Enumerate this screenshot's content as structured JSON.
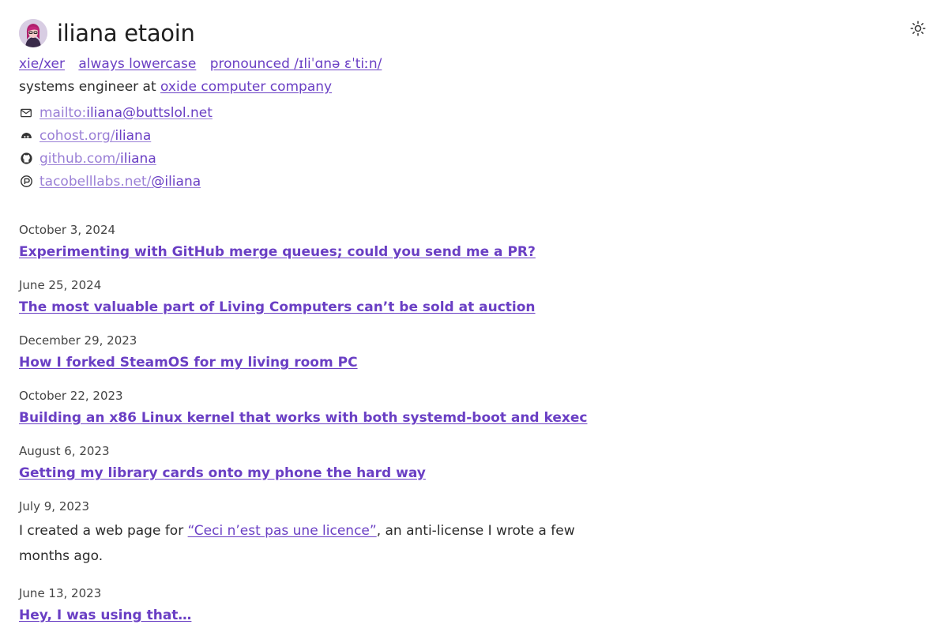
{
  "header": {
    "name": "iliana etaoin",
    "tags": [
      "xie/xer",
      "always lowercase",
      "pronounced /ɪliˈɑnə ɛˈtiːn/"
    ],
    "role_text": "systems engineer at ",
    "company_link": "oxide computer company"
  },
  "contacts": [
    {
      "icon": "mail-icon",
      "prefix": "mailto:",
      "handle": "iliana@buttslol.net"
    },
    {
      "icon": "cohost-icon",
      "prefix": "cohost.org/",
      "handle": "iliana"
    },
    {
      "icon": "github-icon",
      "prefix": "github.com/",
      "handle": "iliana"
    },
    {
      "icon": "mastodon-icon",
      "prefix": "tacobelllabs.net/",
      "handle": "@iliana"
    }
  ],
  "posts": [
    {
      "date": "October 3, 2024",
      "title": "Experimenting with GitHub merge queues; could you send me a PR?"
    },
    {
      "date": "June 25, 2024",
      "title": "The most valuable part of Living Computers can’t be sold at auction"
    },
    {
      "date": "December 29, 2023",
      "title": "How I forked SteamOS for my living room PC"
    },
    {
      "date": "October 22, 2023",
      "title": "Building an x86 Linux kernel that works with both systemd-boot and kexec"
    },
    {
      "date": "August 6, 2023",
      "title": "Getting my library cards onto my phone the hard way"
    },
    {
      "date": "July 9, 2023",
      "note_before": "I created a web page for ",
      "note_link": "“Ceci n’est pas une licence”",
      "note_after": ", an anti-license I wrote a few months ago."
    },
    {
      "date": "June 13, 2023",
      "title": "Hey, I was using that…"
    }
  ],
  "colors": {
    "accent": "#6a3fc4",
    "accent_light": "#9a7fd6",
    "text": "#2c2c2c"
  },
  "theme_toggle_icon": "sun-icon"
}
